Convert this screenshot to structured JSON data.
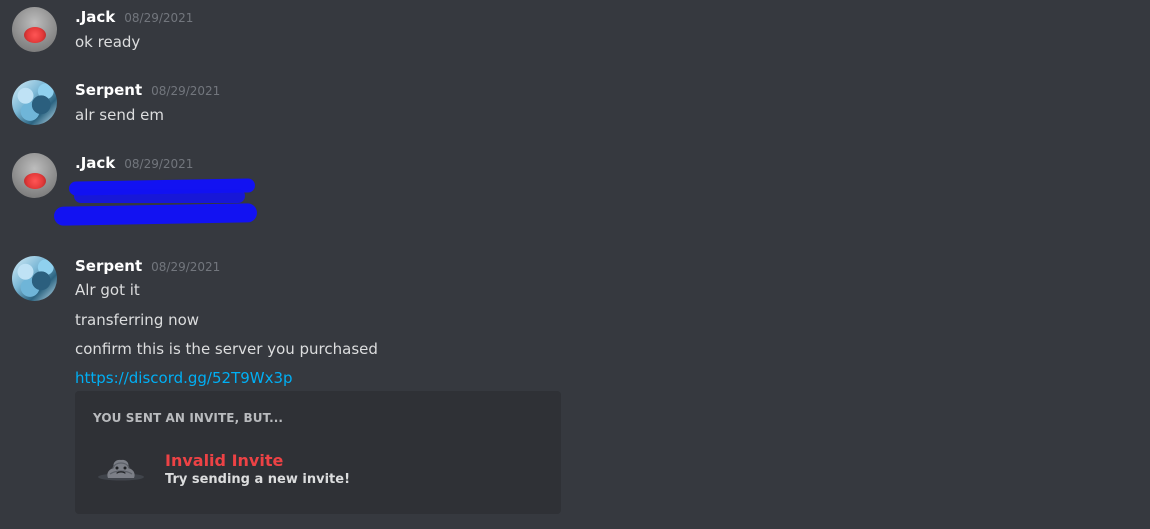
{
  "messages": [
    {
      "username": ".Jack",
      "timestamp": "08/29/2021",
      "avatar": "jack-avatar",
      "lines": [
        "ok ready"
      ]
    },
    {
      "username": "Serpent",
      "timestamp": "08/29/2021",
      "avatar": "serpent-avatar",
      "lines": [
        "alr send em"
      ]
    },
    {
      "username": ".Jack",
      "timestamp": "08/29/2021",
      "avatar": "jack-avatar",
      "lines": []
    },
    {
      "username": "Serpent",
      "timestamp": "08/29/2021",
      "avatar": "serpent-avatar",
      "lines": [
        "Alr got it",
        "transferring now",
        "confirm this is the server you purchased",
        "https://discord.gg/52T9Wx3p"
      ]
    }
  ],
  "invite_embed": {
    "header": "YOU SENT AN INVITE, BUT...",
    "title": "Invalid Invite",
    "subtitle": "Try sending a new invite!",
    "icon": "sad-poop-icon"
  },
  "colors": {
    "background": "#36393f",
    "embed_background": "#2f3136",
    "username": "#ffffff",
    "timestamp": "#72767d",
    "message_text": "#dcddde",
    "link": "#00aff4",
    "invalid": "#ed4245",
    "redaction": "#1212f2"
  }
}
